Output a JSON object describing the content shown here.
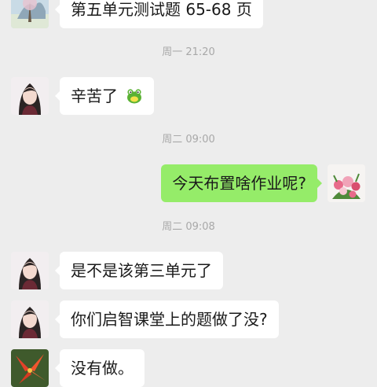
{
  "messages": [
    {
      "type": "in",
      "text": "第五单元测试题 65-68 页",
      "avatar": "landscape"
    },
    {
      "type": "time",
      "text": "周一 21:20"
    },
    {
      "type": "in",
      "text": "辛苦了",
      "emoji": "frog-emoji",
      "avatar": "woman"
    },
    {
      "type": "time",
      "text": "周二 09:00"
    },
    {
      "type": "out",
      "text": "今天布置啥作业呢?",
      "avatar": "flowers"
    },
    {
      "type": "time",
      "text": "周二 09:08"
    },
    {
      "type": "in",
      "text": "是不是该第三单元了",
      "avatar": "woman"
    },
    {
      "type": "in",
      "text": "你们启智课堂上的题做了没?",
      "avatar": "woman"
    },
    {
      "type": "in",
      "text": "没有做。",
      "avatar": "red-flower"
    }
  ],
  "colors": {
    "background": "#ededed",
    "incoming_bubble": "#ffffff",
    "outgoing_bubble": "#95ec69",
    "timestamp": "#a8a8a8"
  }
}
